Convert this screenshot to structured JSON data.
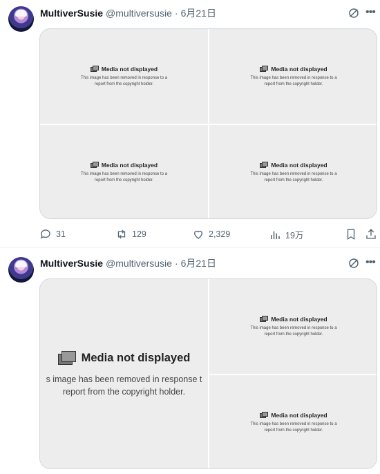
{
  "tweets": [
    {
      "author": {
        "name": "MultiverSusie",
        "handle": "@multiversusie",
        "separator": "·",
        "date": "6月21日"
      },
      "media": {
        "title": "Media not displayed",
        "message_line1": "This image has been removed in response to a",
        "message_line2": "report from the copyright holder."
      },
      "actions": {
        "replies": "31",
        "retweets": "129",
        "likes": "2,329",
        "views": "19万"
      }
    },
    {
      "author": {
        "name": "MultiverSusie",
        "handle": "@multiversusie",
        "separator": "·",
        "date": "6月21日"
      },
      "media": {
        "title": "Media not displayed",
        "message_line1": "This image has been removed in response to a",
        "message_line2": "report from the copyright holder.",
        "big_line1": "s image has been removed in response t",
        "big_line2": "report from the copyright holder."
      }
    }
  ],
  "colors": {
    "text": "#0f1419",
    "muted": "#536471",
    "media_bg": "#ededed",
    "border": "#cfd9de"
  },
  "icons": [
    "avatar",
    "grok-icon",
    "more-icon",
    "reply-icon",
    "retweet-icon",
    "like-icon",
    "views-icon",
    "bookmark-icon",
    "share-icon",
    "media-picture-icon"
  ]
}
